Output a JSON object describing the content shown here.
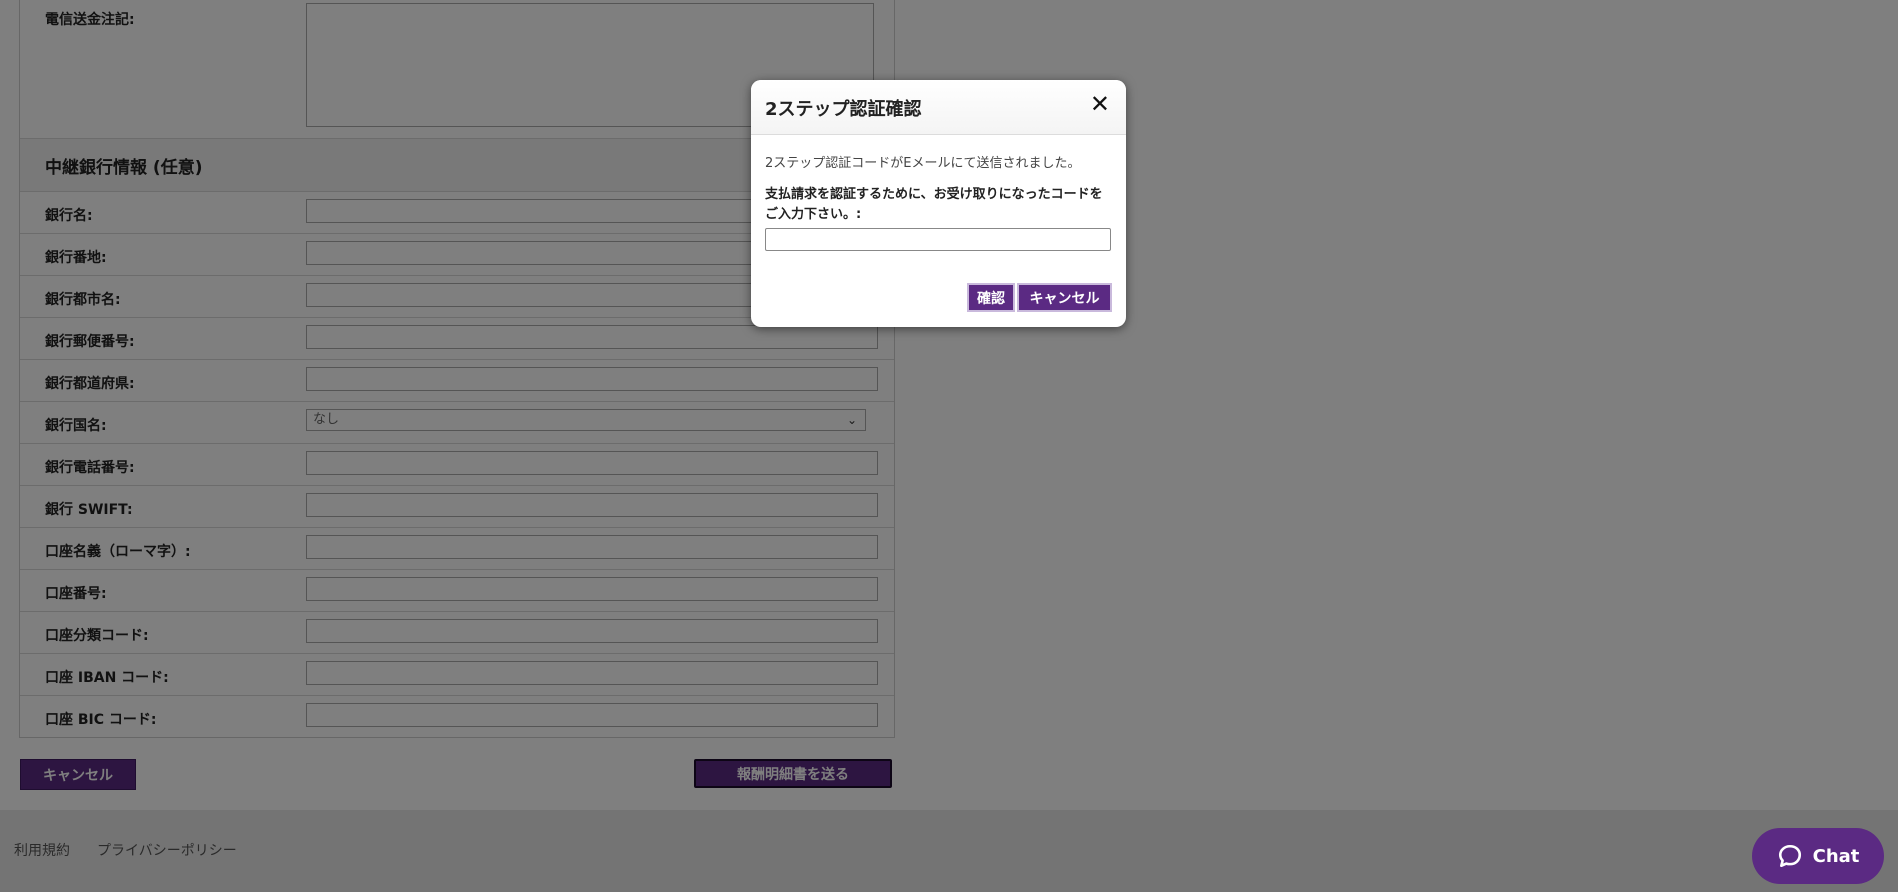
{
  "form": {
    "wire_notes_label": "電信送金注記:",
    "intermediary_section_title": "中継銀行情報 (任意)",
    "rows": [
      {
        "label": "銀行名:"
      },
      {
        "label": "銀行番地:"
      },
      {
        "label": "銀行都市名:"
      },
      {
        "label": "銀行郵便番号:"
      },
      {
        "label": "銀行都道府県:"
      },
      {
        "label": "銀行国名:",
        "select_value": "なし"
      },
      {
        "label": "銀行電話番号:"
      },
      {
        "label": "銀行 SWIFT:"
      },
      {
        "label": "口座名義（ローマ字）:"
      },
      {
        "label": "口座番号:"
      },
      {
        "label": "口座分類コード:"
      },
      {
        "label": "口座 IBAN コード:"
      },
      {
        "label": "口座 BIC コード:"
      }
    ],
    "cancel_label": "キャンセル",
    "send_label": "報酬明細書を送る"
  },
  "footer": {
    "terms_link": "利用規約",
    "privacy_link": "プライバシーポリシー"
  },
  "chat": {
    "label": "Chat",
    "icon": "chat-bubble-icon"
  },
  "modal": {
    "title": "2ステップ認証確認",
    "close_icon": "close-icon",
    "message": "2ステップ認証コードがEメールにて送信されました。",
    "prompt": "支払請求を認証するために、お受け取りになったコードをご入力下さい。:",
    "code_value": "",
    "confirm_label": "確認",
    "cancel_label": "キャンセル"
  },
  "colors": {
    "brand_purple": "#5b2a83",
    "overlay": "rgba(0,0,0,0.5)"
  }
}
